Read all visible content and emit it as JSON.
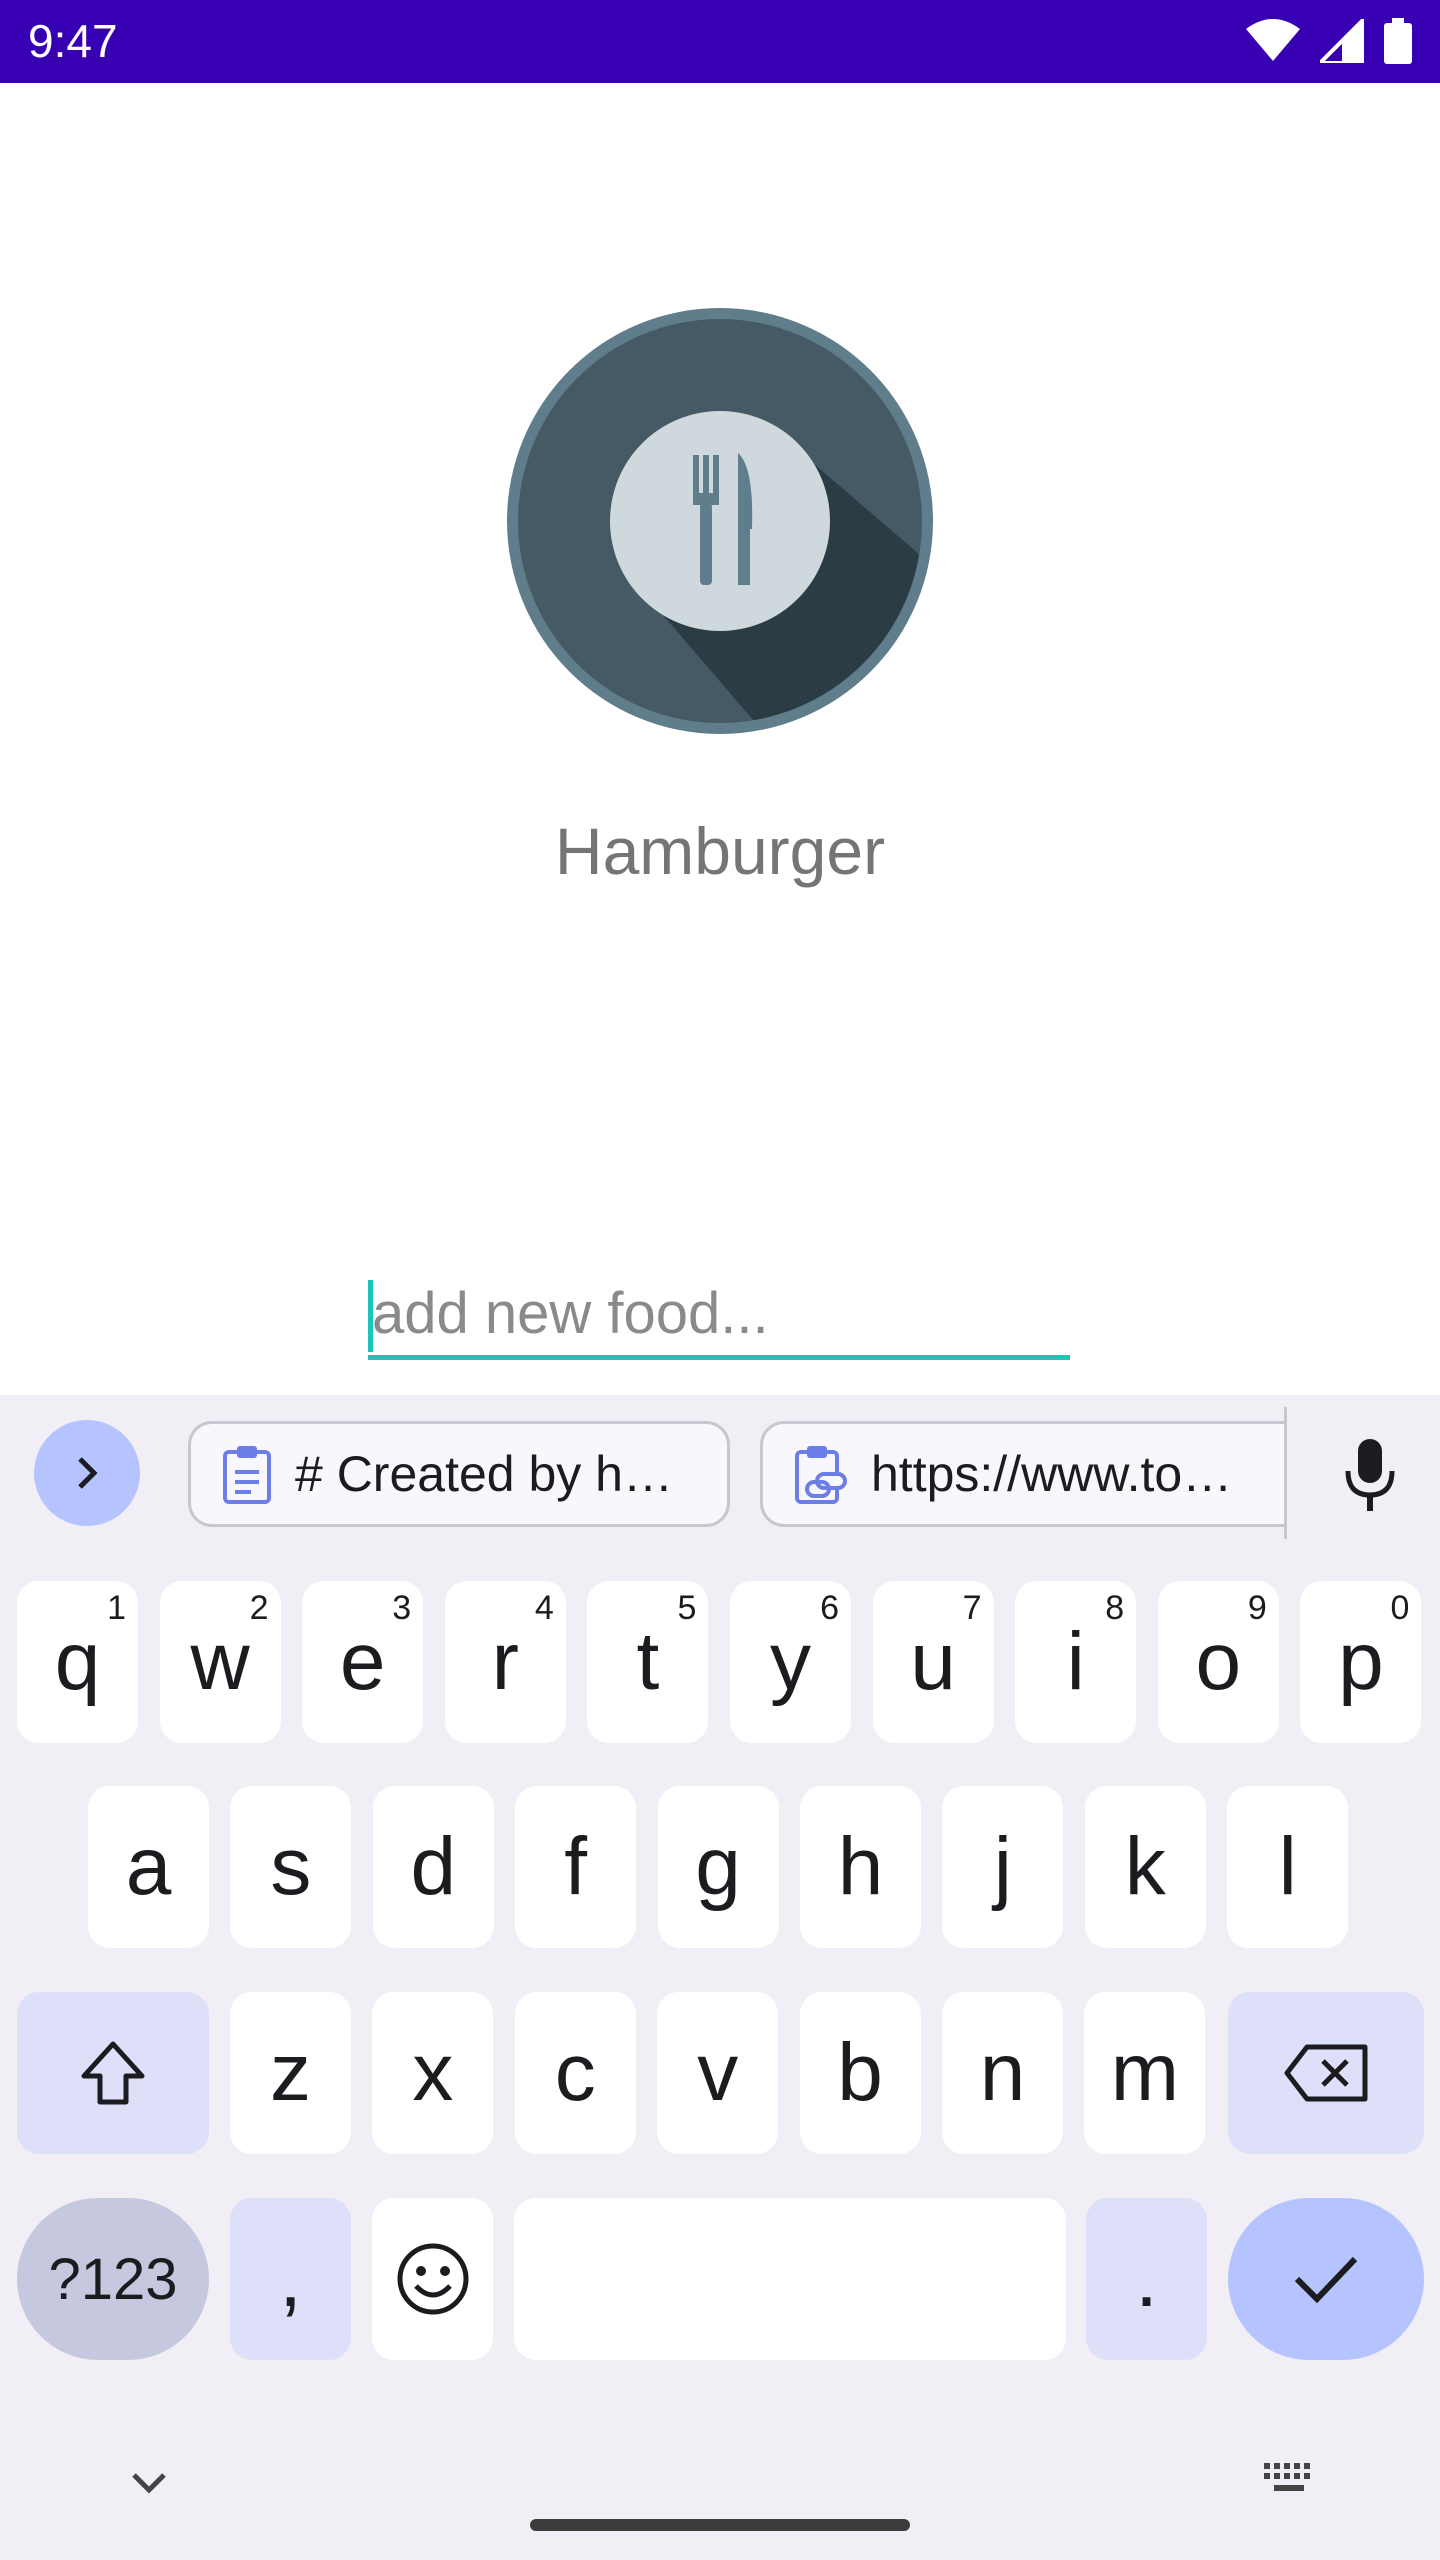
{
  "status_bar": {
    "time": "9:47",
    "bg_color": "#3700b3"
  },
  "food": {
    "name": "Hamburger",
    "icon": "restaurant-icon"
  },
  "input": {
    "placeholder": "add new food...",
    "value": "",
    "accent_color": "#1bc5b8"
  },
  "keyboard": {
    "clipboard": [
      {
        "text": "# Created by h…",
        "icon": "clipboard-icon"
      },
      {
        "text": "https://www.to…",
        "icon": "clipboard-link-icon"
      }
    ],
    "row1": [
      {
        "l": "q",
        "h": "1"
      },
      {
        "l": "w",
        "h": "2"
      },
      {
        "l": "e",
        "h": "3"
      },
      {
        "l": "r",
        "h": "4"
      },
      {
        "l": "t",
        "h": "5"
      },
      {
        "l": "y",
        "h": "6"
      },
      {
        "l": "u",
        "h": "7"
      },
      {
        "l": "i",
        "h": "8"
      },
      {
        "l": "o",
        "h": "9"
      },
      {
        "l": "p",
        "h": "0"
      }
    ],
    "row2": [
      "a",
      "s",
      "d",
      "f",
      "g",
      "h",
      "j",
      "k",
      "l"
    ],
    "row3": [
      "z",
      "x",
      "c",
      "v",
      "b",
      "n",
      "m"
    ],
    "symbols_label": "?123",
    "comma_label": ",",
    "period_label": "."
  }
}
